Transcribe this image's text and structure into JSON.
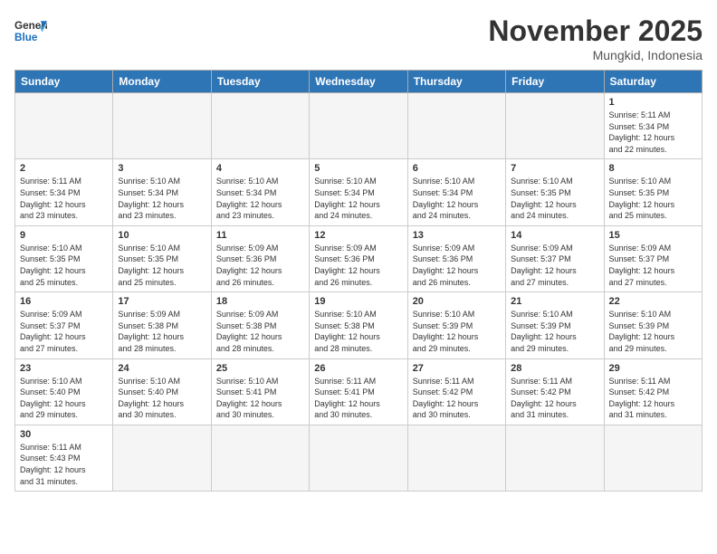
{
  "header": {
    "logo_general": "General",
    "logo_blue": "Blue",
    "month_title": "November 2025",
    "location": "Mungkid, Indonesia"
  },
  "days_of_week": [
    "Sunday",
    "Monday",
    "Tuesday",
    "Wednesday",
    "Thursday",
    "Friday",
    "Saturday"
  ],
  "weeks": [
    [
      {
        "day": "",
        "info": ""
      },
      {
        "day": "",
        "info": ""
      },
      {
        "day": "",
        "info": ""
      },
      {
        "day": "",
        "info": ""
      },
      {
        "day": "",
        "info": ""
      },
      {
        "day": "",
        "info": ""
      },
      {
        "day": "1",
        "info": "Sunrise: 5:11 AM\nSunset: 5:34 PM\nDaylight: 12 hours\nand 22 minutes."
      }
    ],
    [
      {
        "day": "2",
        "info": "Sunrise: 5:11 AM\nSunset: 5:34 PM\nDaylight: 12 hours\nand 23 minutes."
      },
      {
        "day": "3",
        "info": "Sunrise: 5:10 AM\nSunset: 5:34 PM\nDaylight: 12 hours\nand 23 minutes."
      },
      {
        "day": "4",
        "info": "Sunrise: 5:10 AM\nSunset: 5:34 PM\nDaylight: 12 hours\nand 23 minutes."
      },
      {
        "day": "5",
        "info": "Sunrise: 5:10 AM\nSunset: 5:34 PM\nDaylight: 12 hours\nand 24 minutes."
      },
      {
        "day": "6",
        "info": "Sunrise: 5:10 AM\nSunset: 5:34 PM\nDaylight: 12 hours\nand 24 minutes."
      },
      {
        "day": "7",
        "info": "Sunrise: 5:10 AM\nSunset: 5:35 PM\nDaylight: 12 hours\nand 24 minutes."
      },
      {
        "day": "8",
        "info": "Sunrise: 5:10 AM\nSunset: 5:35 PM\nDaylight: 12 hours\nand 25 minutes."
      }
    ],
    [
      {
        "day": "9",
        "info": "Sunrise: 5:10 AM\nSunset: 5:35 PM\nDaylight: 12 hours\nand 25 minutes."
      },
      {
        "day": "10",
        "info": "Sunrise: 5:10 AM\nSunset: 5:35 PM\nDaylight: 12 hours\nand 25 minutes."
      },
      {
        "day": "11",
        "info": "Sunrise: 5:09 AM\nSunset: 5:36 PM\nDaylight: 12 hours\nand 26 minutes."
      },
      {
        "day": "12",
        "info": "Sunrise: 5:09 AM\nSunset: 5:36 PM\nDaylight: 12 hours\nand 26 minutes."
      },
      {
        "day": "13",
        "info": "Sunrise: 5:09 AM\nSunset: 5:36 PM\nDaylight: 12 hours\nand 26 minutes."
      },
      {
        "day": "14",
        "info": "Sunrise: 5:09 AM\nSunset: 5:37 PM\nDaylight: 12 hours\nand 27 minutes."
      },
      {
        "day": "15",
        "info": "Sunrise: 5:09 AM\nSunset: 5:37 PM\nDaylight: 12 hours\nand 27 minutes."
      }
    ],
    [
      {
        "day": "16",
        "info": "Sunrise: 5:09 AM\nSunset: 5:37 PM\nDaylight: 12 hours\nand 27 minutes."
      },
      {
        "day": "17",
        "info": "Sunrise: 5:09 AM\nSunset: 5:38 PM\nDaylight: 12 hours\nand 28 minutes."
      },
      {
        "day": "18",
        "info": "Sunrise: 5:09 AM\nSunset: 5:38 PM\nDaylight: 12 hours\nand 28 minutes."
      },
      {
        "day": "19",
        "info": "Sunrise: 5:10 AM\nSunset: 5:38 PM\nDaylight: 12 hours\nand 28 minutes."
      },
      {
        "day": "20",
        "info": "Sunrise: 5:10 AM\nSunset: 5:39 PM\nDaylight: 12 hours\nand 29 minutes."
      },
      {
        "day": "21",
        "info": "Sunrise: 5:10 AM\nSunset: 5:39 PM\nDaylight: 12 hours\nand 29 minutes."
      },
      {
        "day": "22",
        "info": "Sunrise: 5:10 AM\nSunset: 5:39 PM\nDaylight: 12 hours\nand 29 minutes."
      }
    ],
    [
      {
        "day": "23",
        "info": "Sunrise: 5:10 AM\nSunset: 5:40 PM\nDaylight: 12 hours\nand 29 minutes."
      },
      {
        "day": "24",
        "info": "Sunrise: 5:10 AM\nSunset: 5:40 PM\nDaylight: 12 hours\nand 30 minutes."
      },
      {
        "day": "25",
        "info": "Sunrise: 5:10 AM\nSunset: 5:41 PM\nDaylight: 12 hours\nand 30 minutes."
      },
      {
        "day": "26",
        "info": "Sunrise: 5:11 AM\nSunset: 5:41 PM\nDaylight: 12 hours\nand 30 minutes."
      },
      {
        "day": "27",
        "info": "Sunrise: 5:11 AM\nSunset: 5:42 PM\nDaylight: 12 hours\nand 30 minutes."
      },
      {
        "day": "28",
        "info": "Sunrise: 5:11 AM\nSunset: 5:42 PM\nDaylight: 12 hours\nand 31 minutes."
      },
      {
        "day": "29",
        "info": "Sunrise: 5:11 AM\nSunset: 5:42 PM\nDaylight: 12 hours\nand 31 minutes."
      }
    ],
    [
      {
        "day": "30",
        "info": "Sunrise: 5:11 AM\nSunset: 5:43 PM\nDaylight: 12 hours\nand 31 minutes."
      },
      {
        "day": "",
        "info": ""
      },
      {
        "day": "",
        "info": ""
      },
      {
        "day": "",
        "info": ""
      },
      {
        "day": "",
        "info": ""
      },
      {
        "day": "",
        "info": ""
      },
      {
        "day": "",
        "info": ""
      }
    ]
  ]
}
